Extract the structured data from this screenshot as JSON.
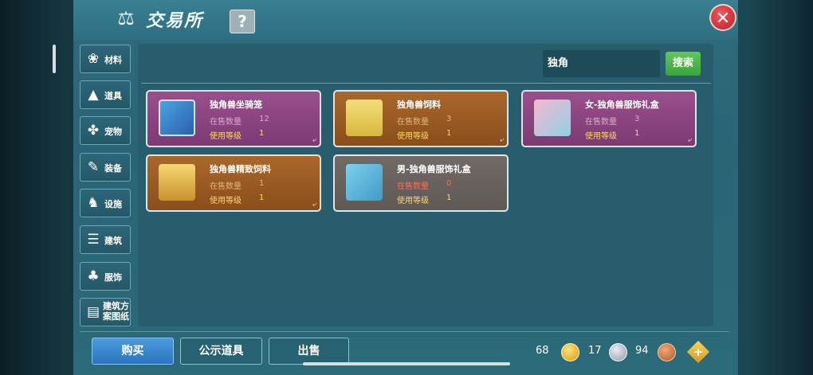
{
  "header": {
    "title": "交易所",
    "help_label": "?",
    "close_label": "✕"
  },
  "categories": [
    {
      "label": "材料",
      "icon": "material-icon",
      "glyph": "❀"
    },
    {
      "label": "道具",
      "icon": "prop-icon",
      "glyph": "▲"
    },
    {
      "label": "宠物",
      "icon": "paw-icon",
      "glyph": "✤"
    },
    {
      "label": "装备",
      "icon": "equipment-icon",
      "glyph": "✎"
    },
    {
      "label": "设施",
      "icon": "facility-icon",
      "glyph": "♞"
    },
    {
      "label": "建筑",
      "icon": "building-icon",
      "glyph": "☰"
    },
    {
      "label": "服饰",
      "icon": "clothing-icon",
      "glyph": "♣"
    },
    {
      "label": "建筑方案图纸",
      "icon": "blueprint-icon",
      "glyph": "▤"
    }
  ],
  "search": {
    "value": "独角",
    "button_label": "搜索"
  },
  "labels": {
    "stock": "在售数量",
    "level": "使用等级"
  },
  "items": [
    {
      "name": "独角兽坐骑笼",
      "stock": "12",
      "level": "1",
      "style": "purple"
    },
    {
      "name": "独角兽饲料",
      "stock": "3",
      "level": "1",
      "style": "gold"
    },
    {
      "name": "女-独角兽服饰礼盒",
      "stock": "3",
      "level": "1",
      "style": "purple"
    },
    {
      "name": "独角兽精致饲料",
      "stock": "1",
      "level": "1",
      "style": "gold"
    },
    {
      "name": "男-独角兽服饰礼盒",
      "stock": "0",
      "level": "1",
      "style": "gray"
    }
  ],
  "footer": {
    "buttons": [
      "购买",
      "公示道具",
      "出售"
    ],
    "currencies": [
      {
        "value": "68",
        "icon": "gold-coin-icon",
        "color": "#e8b21e"
      },
      {
        "value": "17",
        "icon": "silver-coin-icon",
        "color": "#9aa8b2"
      },
      {
        "value": "94",
        "icon": "bronze-coin-icon",
        "color": "#c8743a"
      }
    ],
    "add_label": "+"
  }
}
